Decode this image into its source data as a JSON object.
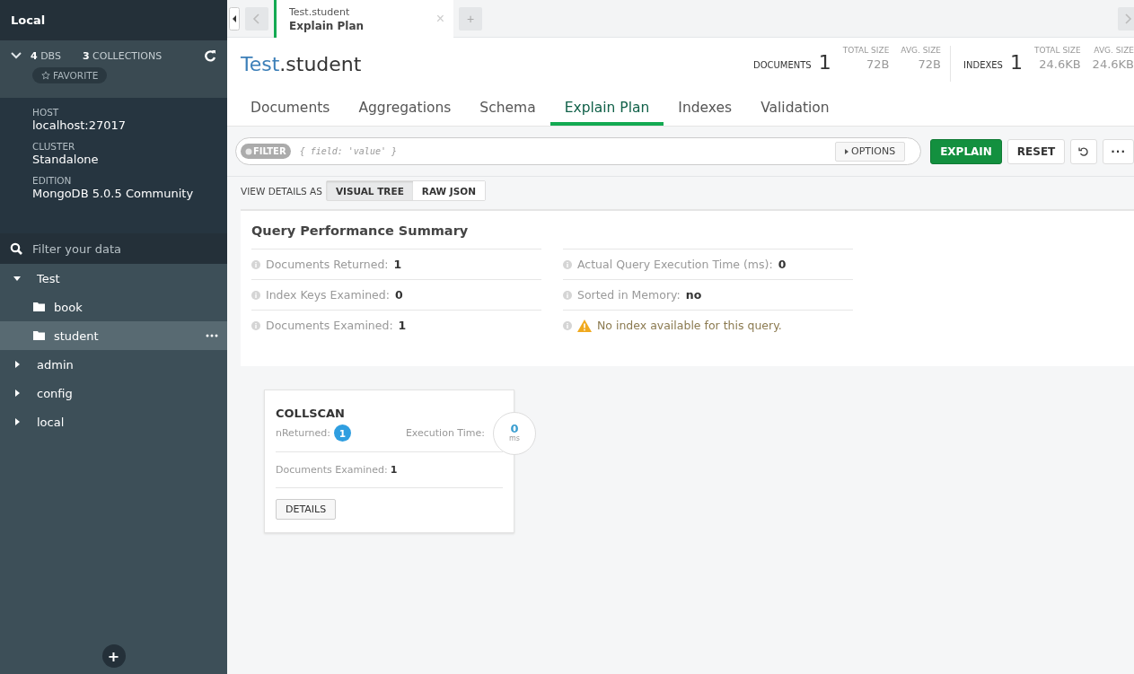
{
  "sidebar": {
    "title": "Local",
    "expanded": true,
    "stats": [
      {
        "count": "4",
        "label": "DBS"
      },
      {
        "count": "3",
        "label": "COLLECTIONS"
      }
    ],
    "favorite": "FAVORITE",
    "details": [
      {
        "label": "HOST",
        "value": "localhost:27017"
      },
      {
        "label": "CLUSTER",
        "value": "Standalone"
      },
      {
        "label": "EDITION",
        "value": "MongoDB 5.0.5 Community"
      }
    ],
    "filter": {
      "placeholder": "Filter your data"
    },
    "tree": [
      {
        "name": "Test",
        "expanded": true,
        "children": [
          {
            "name": "book",
            "selected": false
          },
          {
            "name": "student",
            "selected": true
          }
        ]
      },
      {
        "name": "admin",
        "expanded": false
      },
      {
        "name": "config",
        "expanded": false
      },
      {
        "name": "local",
        "expanded": false
      }
    ],
    "add_button": "+"
  },
  "tabs": [
    {
      "title": "Test.student",
      "subtitle": "Explain Plan",
      "selected": true,
      "close": "×"
    }
  ],
  "new_tab": "+",
  "header": {
    "database": "Test",
    "collection": ".student",
    "stats": [
      {
        "label": "DOCUMENTS",
        "count": "1",
        "metrics": [
          {
            "label": "TOTAL SIZE",
            "value": "72B"
          },
          {
            "label": "AVG. SIZE",
            "value": "72B"
          }
        ]
      },
      {
        "label": "INDEXES",
        "count": "1",
        "metrics": [
          {
            "label": "TOTAL SIZE",
            "value": "24.6KB"
          },
          {
            "label": "AVG. SIZE",
            "value": "24.6KB"
          }
        ]
      }
    ]
  },
  "nav_tabs": [
    {
      "label": "Documents",
      "selected": false
    },
    {
      "label": "Aggregations",
      "selected": false
    },
    {
      "label": "Schema",
      "selected": false
    },
    {
      "label": "Explain Plan",
      "selected": true
    },
    {
      "label": "Indexes",
      "selected": false
    },
    {
      "label": "Validation",
      "selected": false
    }
  ],
  "query_bar": {
    "badge": "FILTER",
    "placeholder": "{ field: 'value' }",
    "options": "OPTIONS",
    "explain": "EXPLAIN",
    "reset": "RESET",
    "more": "···"
  },
  "view_details": {
    "label": "VIEW DETAILS AS",
    "options": [
      {
        "label": "VISUAL TREE",
        "selected": true
      },
      {
        "label": "RAW JSON",
        "selected": false
      }
    ]
  },
  "summary": {
    "title": "Query Performance Summary",
    "columns": [
      [
        {
          "kind": "stat",
          "label": "Documents Returned:",
          "value": "1"
        },
        {
          "kind": "stat",
          "label": "Index Keys Examined:",
          "value": "0"
        },
        {
          "kind": "stat",
          "label": "Documents Examined:",
          "value": "1"
        }
      ],
      [
        {
          "kind": "stat",
          "label": "Actual Query Execution Time (ms):",
          "value": "0"
        },
        {
          "kind": "stat",
          "label": "Sorted in Memory:",
          "value": "no"
        },
        {
          "kind": "warning",
          "label": "No index available for this query."
        }
      ]
    ]
  },
  "stage": {
    "name": "COLLSCAN",
    "returned_label": "nReturned:",
    "returned": "1",
    "time_label": "Execution Time:",
    "time": "0",
    "time_unit": "ms",
    "examined_label": "Documents Examined:",
    "examined": "1",
    "details": "DETAILS"
  }
}
